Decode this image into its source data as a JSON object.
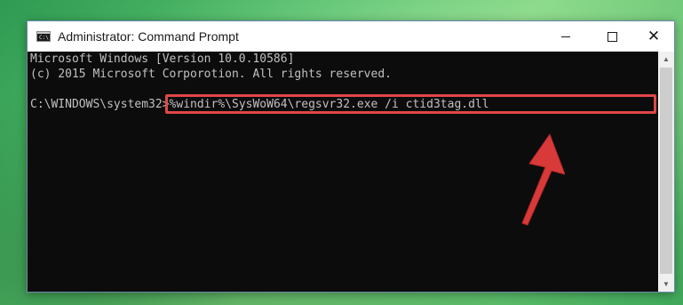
{
  "window": {
    "title": "Administrator: Command Prompt",
    "icon": "cmd-icon",
    "controls": {
      "minimize": "minimize-icon",
      "maximize": "maximize-icon",
      "close": "close-icon"
    }
  },
  "console": {
    "lines": [
      "Microsoft Windows [Version 10.0.10586]",
      "(c) 2015 Microsoft Corporotion. All rights reserved."
    ],
    "prompt": "C:\\WINDOWS\\system32>",
    "command": "%windir%\\SysWoW64\\regsvr32.exe /i ctid3tag.dll"
  },
  "annotation": {
    "highlight_color": "#e04646",
    "arrow_icon": "red-arrow-icon"
  },
  "colors": {
    "console_bg": "#0c0c0c",
    "console_text": "#c0c0c0",
    "desktop_bg": "#5cc56f"
  }
}
